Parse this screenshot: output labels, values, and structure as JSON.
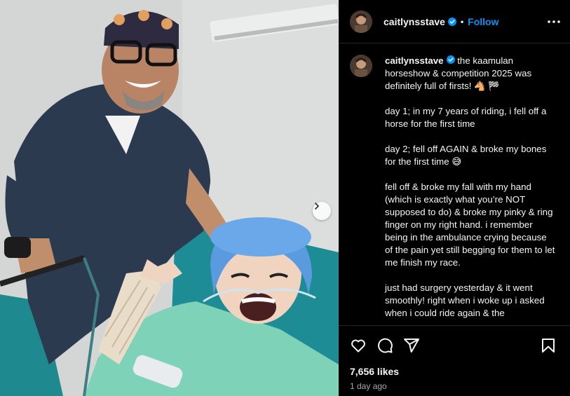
{
  "post": {
    "username": "caitlynsstave",
    "follow_label": "Follow",
    "separator": "•",
    "caption": " the kaamulan horseshow & competition 2025 was definitely full of firsts! 🐴 🏁\n\nday 1; in my 7 years of riding, i fell off a horse for the first time\n\nday 2; fell off AGAIN & broke my bones for the first time 😅\n\nfell off & broke my fall with my hand (which is exactly what you’re NOT supposed to do) & broke my pinky & ring finger on my right hand. i remember being in the ambulance crying because of the pain yet still begging for them to let me finish my race.\n\njust had surgery yesterday & it went smoothly! right when i woke up i asked when i could ride again & the",
    "likes": "7,656 likes",
    "time_ago": "1 day ago"
  },
  "icons": {
    "verified": "verified-badge-icon",
    "more": "more-options-icon",
    "like": "heart-icon",
    "comment": "comment-icon",
    "share": "share-icon",
    "save": "bookmark-icon",
    "next": "chevron-right-icon"
  },
  "colors": {
    "background": "#000000",
    "accent": "#0095f6",
    "muted": "#a8a8a8",
    "divider": "#262626"
  }
}
